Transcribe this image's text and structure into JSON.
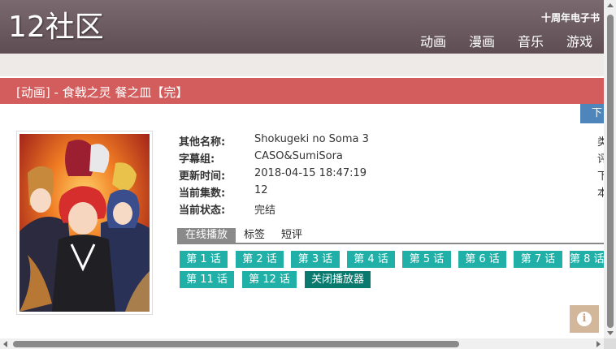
{
  "header": {
    "logo": "12社区",
    "anniversary_link": "十周年电子书",
    "nav": [
      "动画",
      "漫画",
      "音乐",
      "游戏"
    ]
  },
  "title_bar": {
    "text": "[动画] - 食戟之灵 餐之皿【完】"
  },
  "download_button": "下",
  "poster_icon": "anime-poster-image",
  "info": [
    {
      "label": "其他名称:",
      "value": "Shokugeki no Soma 3"
    },
    {
      "label": "字幕组:",
      "value": "CASO&SumiSora"
    },
    {
      "label": "更新时间:",
      "value": "2018-04-15 18:47:19"
    },
    {
      "label": "当前集数:",
      "value": "12"
    },
    {
      "label": "当前状态:",
      "value": "完结"
    }
  ],
  "right_col": [
    "类",
    "评",
    "下",
    "本"
  ],
  "tabs": [
    "在线播放",
    "标签",
    "短评"
  ],
  "episodes": [
    "第 1 话",
    "第 2 话",
    "第 3 话",
    "第 4 话",
    "第 5 话",
    "第 6 话",
    "第 7 话",
    "第 8 话",
    "第 11 话",
    "第 12 话"
  ],
  "close_player": "关闭播放器",
  "info_fab": "i",
  "colors": {
    "header": "#6d5c62",
    "title_bar": "#d35c5c",
    "episode": "#21b0a8",
    "close_player": "#0b7a6e",
    "download": "#4e86bb"
  }
}
